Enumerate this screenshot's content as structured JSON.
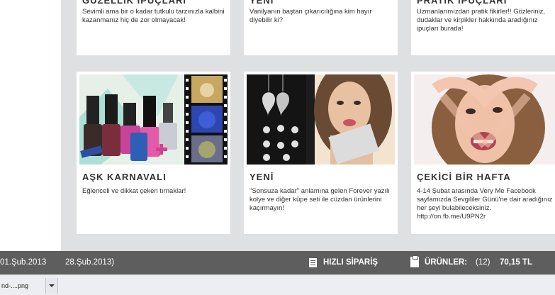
{
  "row1": [
    {
      "title": "GÜZELLİK İPUÇLARI",
      "desc": "Sevimli ama bir o kadar tutkulu tarzınızla kalbini kazanmanız hiç de zor olmayacak!"
    },
    {
      "title": "YENİ",
      "desc": "Vanilyanın baştan çıkarıcılığına kim hayır diyebilir ki?"
    },
    {
      "title": "PRATİK İPUÇLARI",
      "desc": "Uzmanlarımızdan pratik fikirler!! Gözleriniz, dudaklar ve kirpikler hakkında aradığınız ipuçları burada!"
    }
  ],
  "row2": [
    {
      "title": "AŞK KARNAVALI",
      "desc": "Eğlenceli ve dikkat çeken tırnaklar!"
    },
    {
      "title": "YENİ",
      "desc": "\"Sonsuza kadar\" anlamına gelen Forever yazılı kolye ve diğer küpe seti ile cüzdan ürünlerini kaçırmayın!"
    },
    {
      "title": "ÇEKİCİ BİR HAFTA",
      "desc": "4-14 Şubat arasında Very Me Facebook sayfamızda Sevgililer Günü'ne dair aradığınız her şeyi bulabileceksiniz. http://on.fb.me/U9PN2r"
    }
  ],
  "footer": {
    "date_start": "01.Şub.2013",
    "date_end": "28.Şub.2013)",
    "quick_order": "HIZLI SİPARİŞ",
    "products_label": "ÜRÜNLER:",
    "products_count": "(12)",
    "total": "70,15 TL"
  },
  "download": {
    "filename": "nd-....png"
  }
}
